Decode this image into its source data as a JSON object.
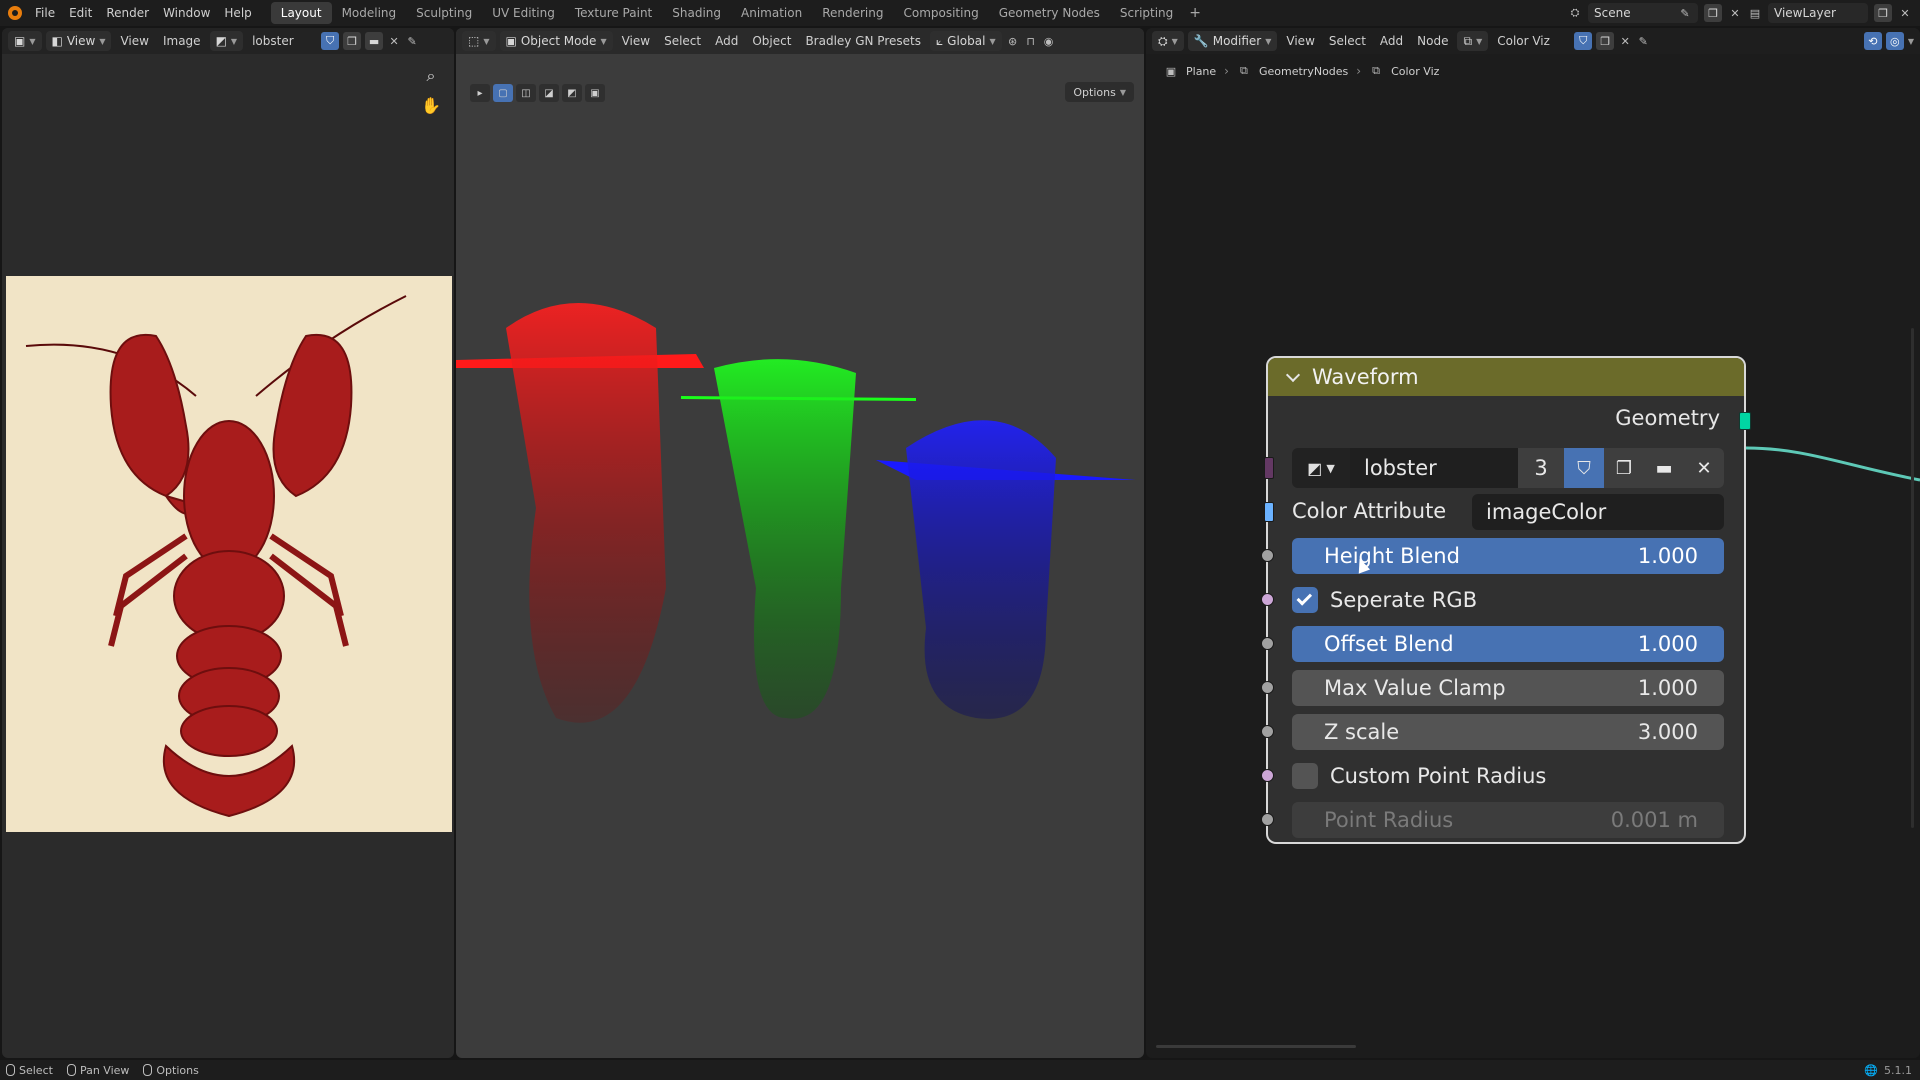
{
  "menu": {
    "items": [
      "File",
      "Edit",
      "Render",
      "Window",
      "Help"
    ]
  },
  "workspaces": [
    {
      "label": "Layout",
      "active": true
    },
    {
      "label": "Modeling",
      "active": false
    },
    {
      "label": "Sculpting",
      "active": false
    },
    {
      "label": "UV Editing",
      "active": false
    },
    {
      "label": "Texture Paint",
      "active": false
    },
    {
      "label": "Shading",
      "active": false
    },
    {
      "label": "Animation",
      "active": false
    },
    {
      "label": "Rendering",
      "active": false
    },
    {
      "label": "Compositing",
      "active": false
    },
    {
      "label": "Geometry Nodes",
      "active": false
    },
    {
      "label": "Scripting",
      "active": false
    }
  ],
  "topbar_right": {
    "scene": "Scene",
    "view_layer": "ViewLayer"
  },
  "image_editor": {
    "view_mode": "View",
    "menu": [
      "View",
      "Image"
    ],
    "image_name": "lobster"
  },
  "viewport": {
    "mode": "Object Mode",
    "menu": [
      "View",
      "Select",
      "Add",
      "Object",
      "Bradley GN Presets"
    ],
    "orientation": "Global",
    "options": "Options",
    "colors": {
      "red": "#ff1a1a",
      "green": "#1aff1a",
      "blue": "#1a1aff"
    }
  },
  "node_editor": {
    "editor_type": "Modifier",
    "menu": [
      "View",
      "Select",
      "Add",
      "Node"
    ],
    "node_group": "Color Viz",
    "breadcrumb": [
      "Plane",
      "GeometryNodes",
      "Color Viz"
    ]
  },
  "node": {
    "title": "Waveform",
    "output_label": "Geometry",
    "image": {
      "name": "lobster",
      "users": "3"
    },
    "color_attribute": {
      "label": "Color Attribute",
      "value": "imageColor"
    },
    "height_blend": {
      "label": "Height Blend",
      "value": "1.000"
    },
    "seperate_rgb": {
      "label": "Seperate RGB",
      "checked": true
    },
    "offset_blend": {
      "label": "Offset Blend",
      "value": "1.000"
    },
    "max_value_clamp": {
      "label": "Max Value Clamp",
      "value": "1.000"
    },
    "z_scale": {
      "label": "Z scale",
      "value": "3.000"
    },
    "custom_point_radius": {
      "label": "Custom Point Radius",
      "checked": false
    },
    "point_radius": {
      "label": "Point Radius",
      "value": "0.001 m"
    }
  },
  "status": {
    "select": "Select",
    "pan_view": "Pan View",
    "options": "Options",
    "version": "5.1.1"
  }
}
